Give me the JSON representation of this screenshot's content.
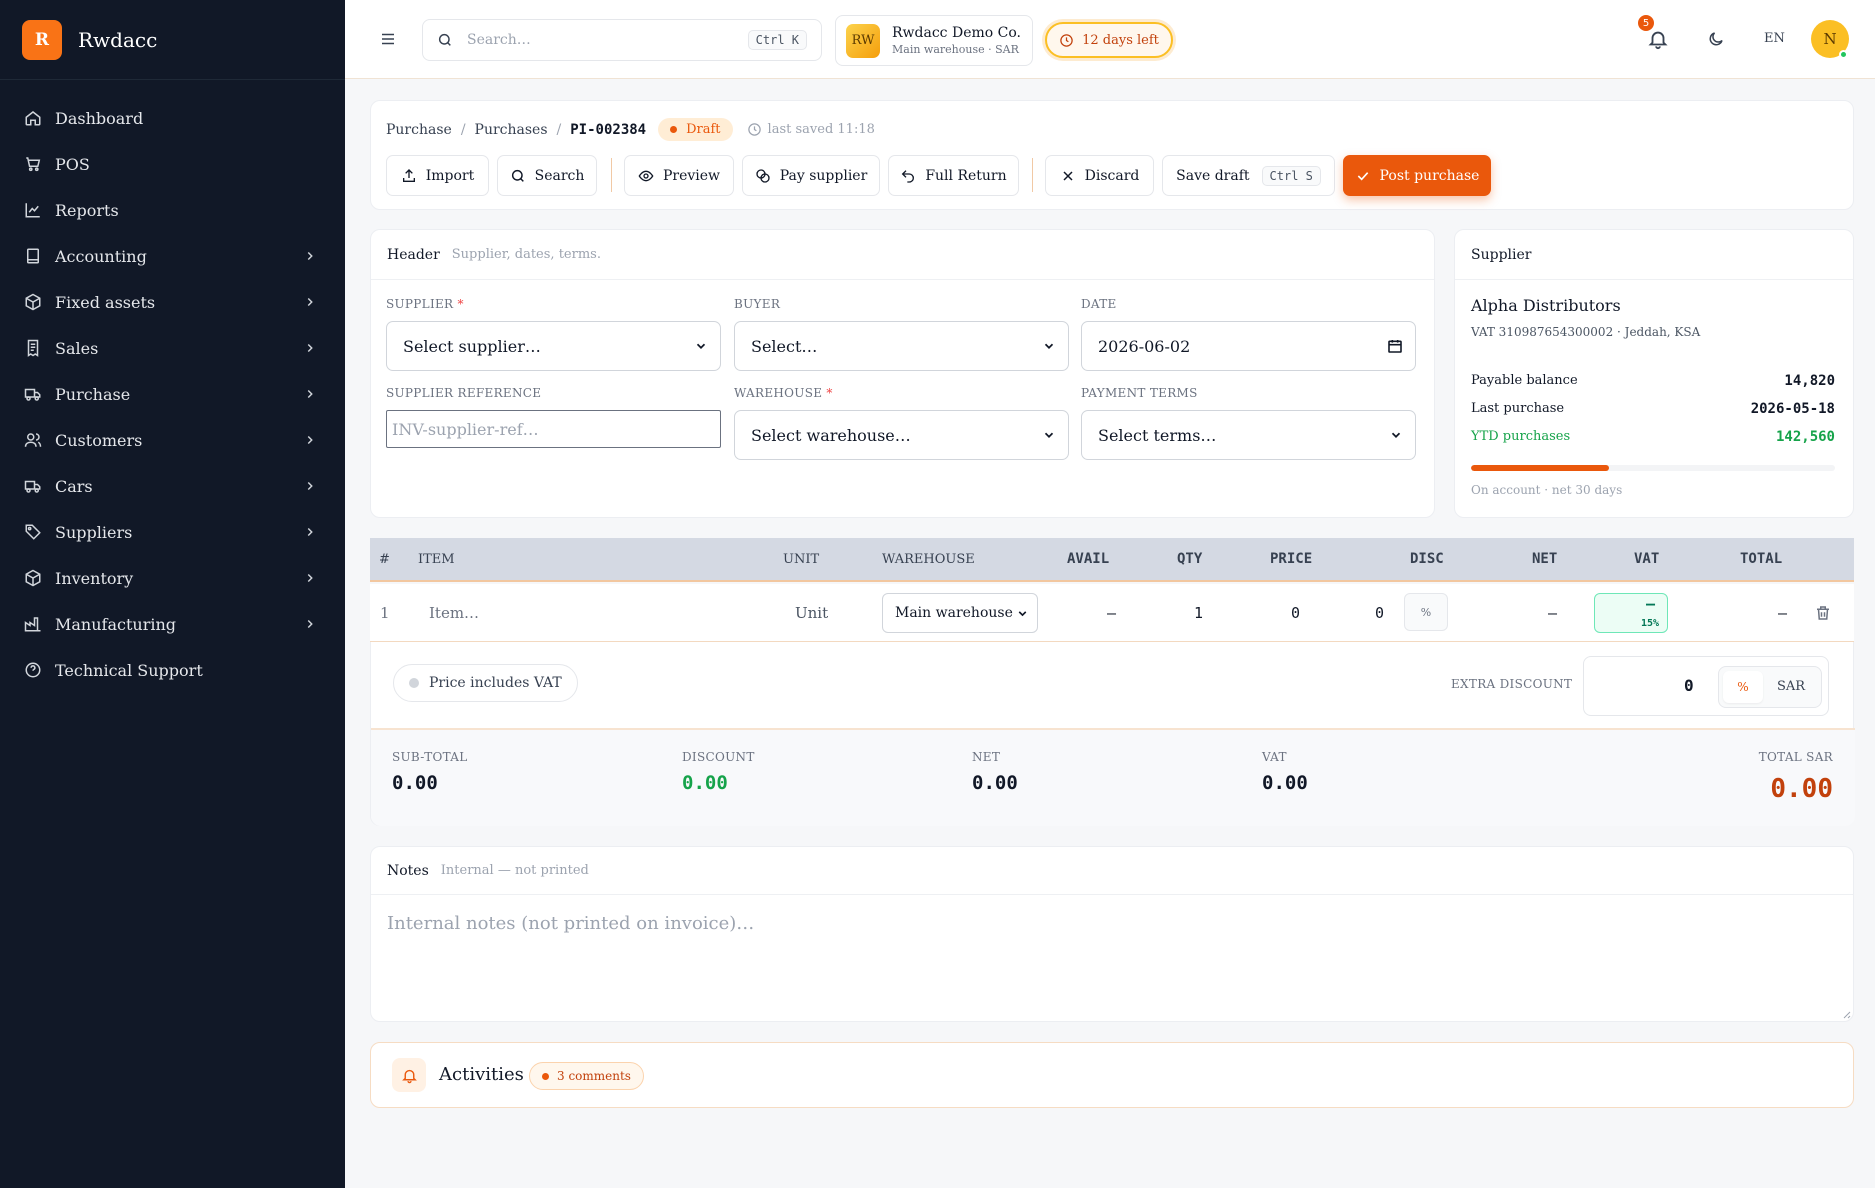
{
  "app": {
    "logo_letter": "R",
    "name": "Rwdacc"
  },
  "sidebar": {
    "items": [
      {
        "label": "Dashboard",
        "icon": "home-icon",
        "has_children": false
      },
      {
        "label": "POS",
        "icon": "cart-icon",
        "has_children": false
      },
      {
        "label": "Reports",
        "icon": "chart-line-icon",
        "has_children": false
      },
      {
        "label": "Accounting",
        "icon": "book-icon",
        "has_children": true
      },
      {
        "label": "Fixed assets",
        "icon": "box-icon",
        "has_children": true
      },
      {
        "label": "Sales",
        "icon": "receipt-icon",
        "has_children": true
      },
      {
        "label": "Purchase",
        "icon": "truck-icon",
        "has_children": true
      },
      {
        "label": "Customers",
        "icon": "users-icon",
        "has_children": true
      },
      {
        "label": "Cars",
        "icon": "car-icon",
        "has_children": true
      },
      {
        "label": "Suppliers",
        "icon": "tag-icon",
        "has_children": true
      },
      {
        "label": "Inventory",
        "icon": "package-icon",
        "has_children": true
      },
      {
        "label": "Manufacturing",
        "icon": "factory-icon",
        "has_children": true
      },
      {
        "label": "Technical Support",
        "icon": "help-circle-icon",
        "has_children": false
      }
    ]
  },
  "topbar": {
    "search_placeholder": "Search…",
    "search_shortcut": "Ctrl K",
    "company_initials": "RW",
    "company_name": "Rwdacc Demo Co.",
    "company_sub": "Main warehouse · SAR",
    "trial_text": "12 days left",
    "notifications_count": "5",
    "language": "EN",
    "user_initial": "N"
  },
  "breadcrumb": {
    "items": [
      "Purchase",
      "Purchases"
    ],
    "doc_number": "PI-002384",
    "status": "Draft",
    "last_saved": "last saved 11:18"
  },
  "toolbar": {
    "import": "Import",
    "search": "Search",
    "preview": "Preview",
    "pay_supplier": "Pay supplier",
    "full_return": "Full Return",
    "discard": "Discard",
    "save_draft": "Save draft",
    "save_shortcut": "Ctrl S",
    "post": "Post purchase"
  },
  "header_card": {
    "title": "Header",
    "subtitle": "Supplier, dates, terms.",
    "supplier_label": "SUPPLIER",
    "supplier_value": "Select supplier…",
    "buyer_label": "BUYER",
    "buyer_value": "Select…",
    "date_label": "DATE",
    "date_value": "2026-06-02",
    "ref_label": "SUPPLIER REFERENCE",
    "ref_placeholder": "INV-supplier-ref…",
    "warehouse_label": "WAREHOUSE",
    "warehouse_value": "Select warehouse…",
    "terms_label": "PAYMENT TERMS",
    "terms_value": "Select terms…",
    "required_mark": "*"
  },
  "supplier_card": {
    "title": "Supplier",
    "name": "Alpha Distributors",
    "vat_line": "VAT 310987654300002 · Jeddah, KSA",
    "payable_label": "Payable balance",
    "payable_value": "14,820",
    "last_purchase_label": "Last purchase",
    "last_purchase_value": "2026-05-18",
    "ytd_label": "YTD purchases",
    "ytd_value": "142,560",
    "progress_fraction": 0.38,
    "note": "On account · net 30 days"
  },
  "lines_table": {
    "headers": {
      "num": "#",
      "item": "ITEM",
      "unit": "UNIT",
      "warehouse": "WAREHOUSE",
      "avail": "AVAIL",
      "qty": "QTY",
      "price": "PRICE",
      "disc": "DISC",
      "net": "NET",
      "vat": "VAT",
      "total": "TOTAL"
    },
    "rows": [
      {
        "num": "1",
        "item": "Item…",
        "unit": "Unit",
        "warehouse": "Main warehouse",
        "avail": "–",
        "qty": "1",
        "price": "0",
        "disc": "0",
        "disc_type": "%",
        "net": "–",
        "vat": "–",
        "vat_rate": "15%",
        "total": "–"
      }
    ]
  },
  "totals": {
    "price_includes_vat": "Price includes VAT",
    "extra_discount_label": "EXTRA DISCOUNT",
    "extra_discount_value": "0",
    "extra_discount_pct": "%",
    "extra_discount_currency": "SAR",
    "subtotal_label": "SUB-TOTAL",
    "subtotal": "0.00",
    "discount_label": "DISCOUNT",
    "discount": "0.00",
    "net_label": "NET",
    "net": "0.00",
    "vat_label": "VAT",
    "vat": "0.00",
    "total_label": "TOTAL SAR",
    "total": "0.00"
  },
  "notes": {
    "title": "Notes",
    "subtitle": "Internal — not printed",
    "placeholder": "Internal notes (not printed on invoice)…"
  },
  "activities": {
    "title": "Activities",
    "badge": "3 comments"
  },
  "colors": {
    "accent": "#ea580c",
    "sidebar_bg": "#111827",
    "success": "#16a34a"
  }
}
